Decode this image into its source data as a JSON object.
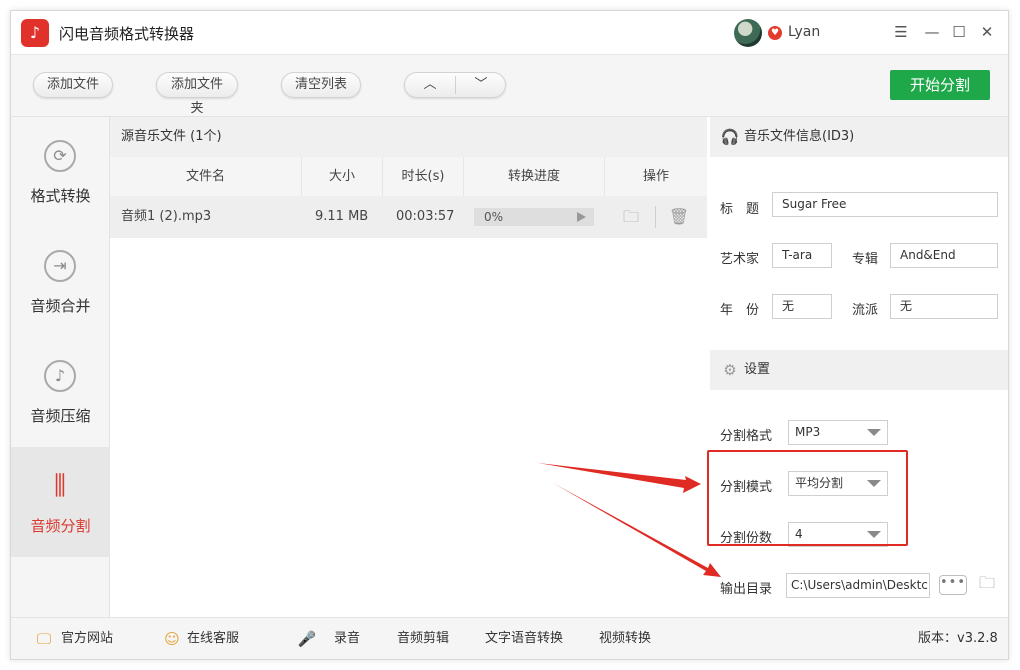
{
  "app": {
    "title": "闪电音频格式转换器",
    "logo_glyph": "♪"
  },
  "user": {
    "name": "Lyan",
    "vip_glyph": "♥"
  },
  "window_controls": {
    "menu": "☰",
    "minimize": "—",
    "maximize": "☐",
    "close": "✕"
  },
  "toolbar": {
    "add_file": "添加文件",
    "add_folder": "添加文件夹",
    "clear_list": "清空列表",
    "move_up": "︿",
    "move_down": "﹀",
    "start": "开始分割",
    "start_color": "#1ea84a"
  },
  "sidebar": {
    "items": [
      {
        "label": "格式转换",
        "icon": "refresh-icon",
        "glyph": "⟳"
      },
      {
        "label": "音频合并",
        "icon": "merge-icon",
        "glyph": "⇥"
      },
      {
        "label": "音频压缩",
        "icon": "music-note-icon",
        "glyph": "♪"
      },
      {
        "label": "音频分割",
        "icon": "split-icon",
        "glyph": "⫼",
        "active": true
      }
    ],
    "active_color": "#d93a30"
  },
  "file_panel": {
    "header": "源音乐文件 (1个)",
    "columns": [
      "文件名",
      "大小",
      "时长(s)",
      "转换进度",
      "操作"
    ],
    "rows": [
      {
        "name": "音频1 (2).mp3",
        "size": "9.11 MB",
        "duration": "00:03:57",
        "progress_text": "0%",
        "progress": 0
      }
    ],
    "folder_glyph": "🗀",
    "trash_glyph": "🗑"
  },
  "id3": {
    "header": "音乐文件信息(ID3)",
    "header_glyph": "🎧",
    "title_label": "标　题",
    "title_value": "Sugar Free",
    "artist_label": "艺术家",
    "artist_value": "T-ara",
    "album_label": "专辑",
    "album_value": "And&End",
    "year_label": "年　份",
    "year_value": "无",
    "genre_label": "流派",
    "genre_value": "无"
  },
  "settings": {
    "header": "设置",
    "header_glyph": "⚙",
    "format_label": "分割格式",
    "format_value": "MP3",
    "mode_label": "分割模式",
    "mode_value": "平均分割",
    "count_label": "分割份数",
    "count_value": "4",
    "output_label": "输出目录",
    "output_value": "C:\\Users\\admin\\Desktc",
    "more_glyph": "•••",
    "folder_glyph": "🗀"
  },
  "footer": {
    "website": "官方网站",
    "website_glyph": "🖵",
    "support": "在线客服",
    "support_glyph": "☺",
    "record_glyph": "🎤",
    "record": "录音",
    "audio_edit": "音频剪辑",
    "tts": "文字语音转换",
    "video": "视频转换",
    "version": "版本：v3.2.8"
  },
  "annotation_color": "#e02a24"
}
